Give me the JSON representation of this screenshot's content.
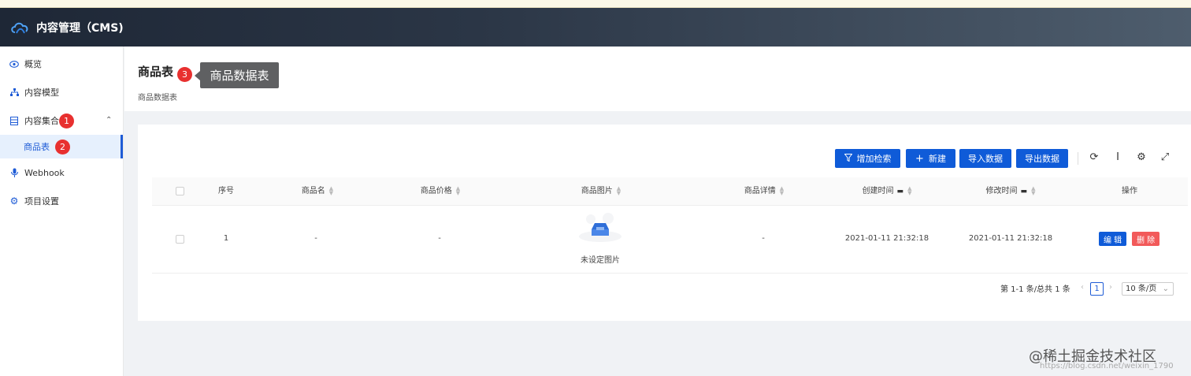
{
  "app": {
    "title": "内容管理（CMS)"
  },
  "sidebar": {
    "items": [
      {
        "label": "概览",
        "icon": "eye-icon"
      },
      {
        "label": "内容模型",
        "icon": "sitemap-icon"
      },
      {
        "label": "内容集合",
        "icon": "list-icon",
        "badge": "1"
      },
      {
        "label": "Webhook",
        "icon": "webhook-icon"
      },
      {
        "label": "项目设置",
        "icon": "gear-icon"
      }
    ],
    "sub": {
      "label": "商品表",
      "badge": "2"
    }
  },
  "page": {
    "title": "商品表",
    "title_badge": "3",
    "subtitle": "商品数据表",
    "tooltip": "商品数据表"
  },
  "toolbar": {
    "filter": "增加检索",
    "new": "新建",
    "import": "导入数据",
    "export": "导出数据"
  },
  "table": {
    "headers": [
      "序号",
      "商品名",
      "商品价格",
      "商品图片",
      "商品详情",
      "创建时间",
      "修改时间",
      "操作"
    ],
    "row": {
      "index": "1",
      "name": "-",
      "price": "-",
      "image_caption": "未设定图片",
      "detail": "-",
      "created": "2021-01-11 21:32:18",
      "modified": "2021-01-11 21:32:18",
      "edit": "编 辑",
      "delete": "删 除"
    }
  },
  "pagination": {
    "summary": "第 1-1 条/总共 1 条",
    "current": "1",
    "page_size": "10 条/页"
  },
  "watermark": {
    "main": "@稀土掘金技术社区",
    "sub": "https://blog.csdn.net/weixin_1790"
  },
  "colors": {
    "primary": "#0f5bd8",
    "danger": "#f25a5a",
    "badge": "#e8302f"
  }
}
